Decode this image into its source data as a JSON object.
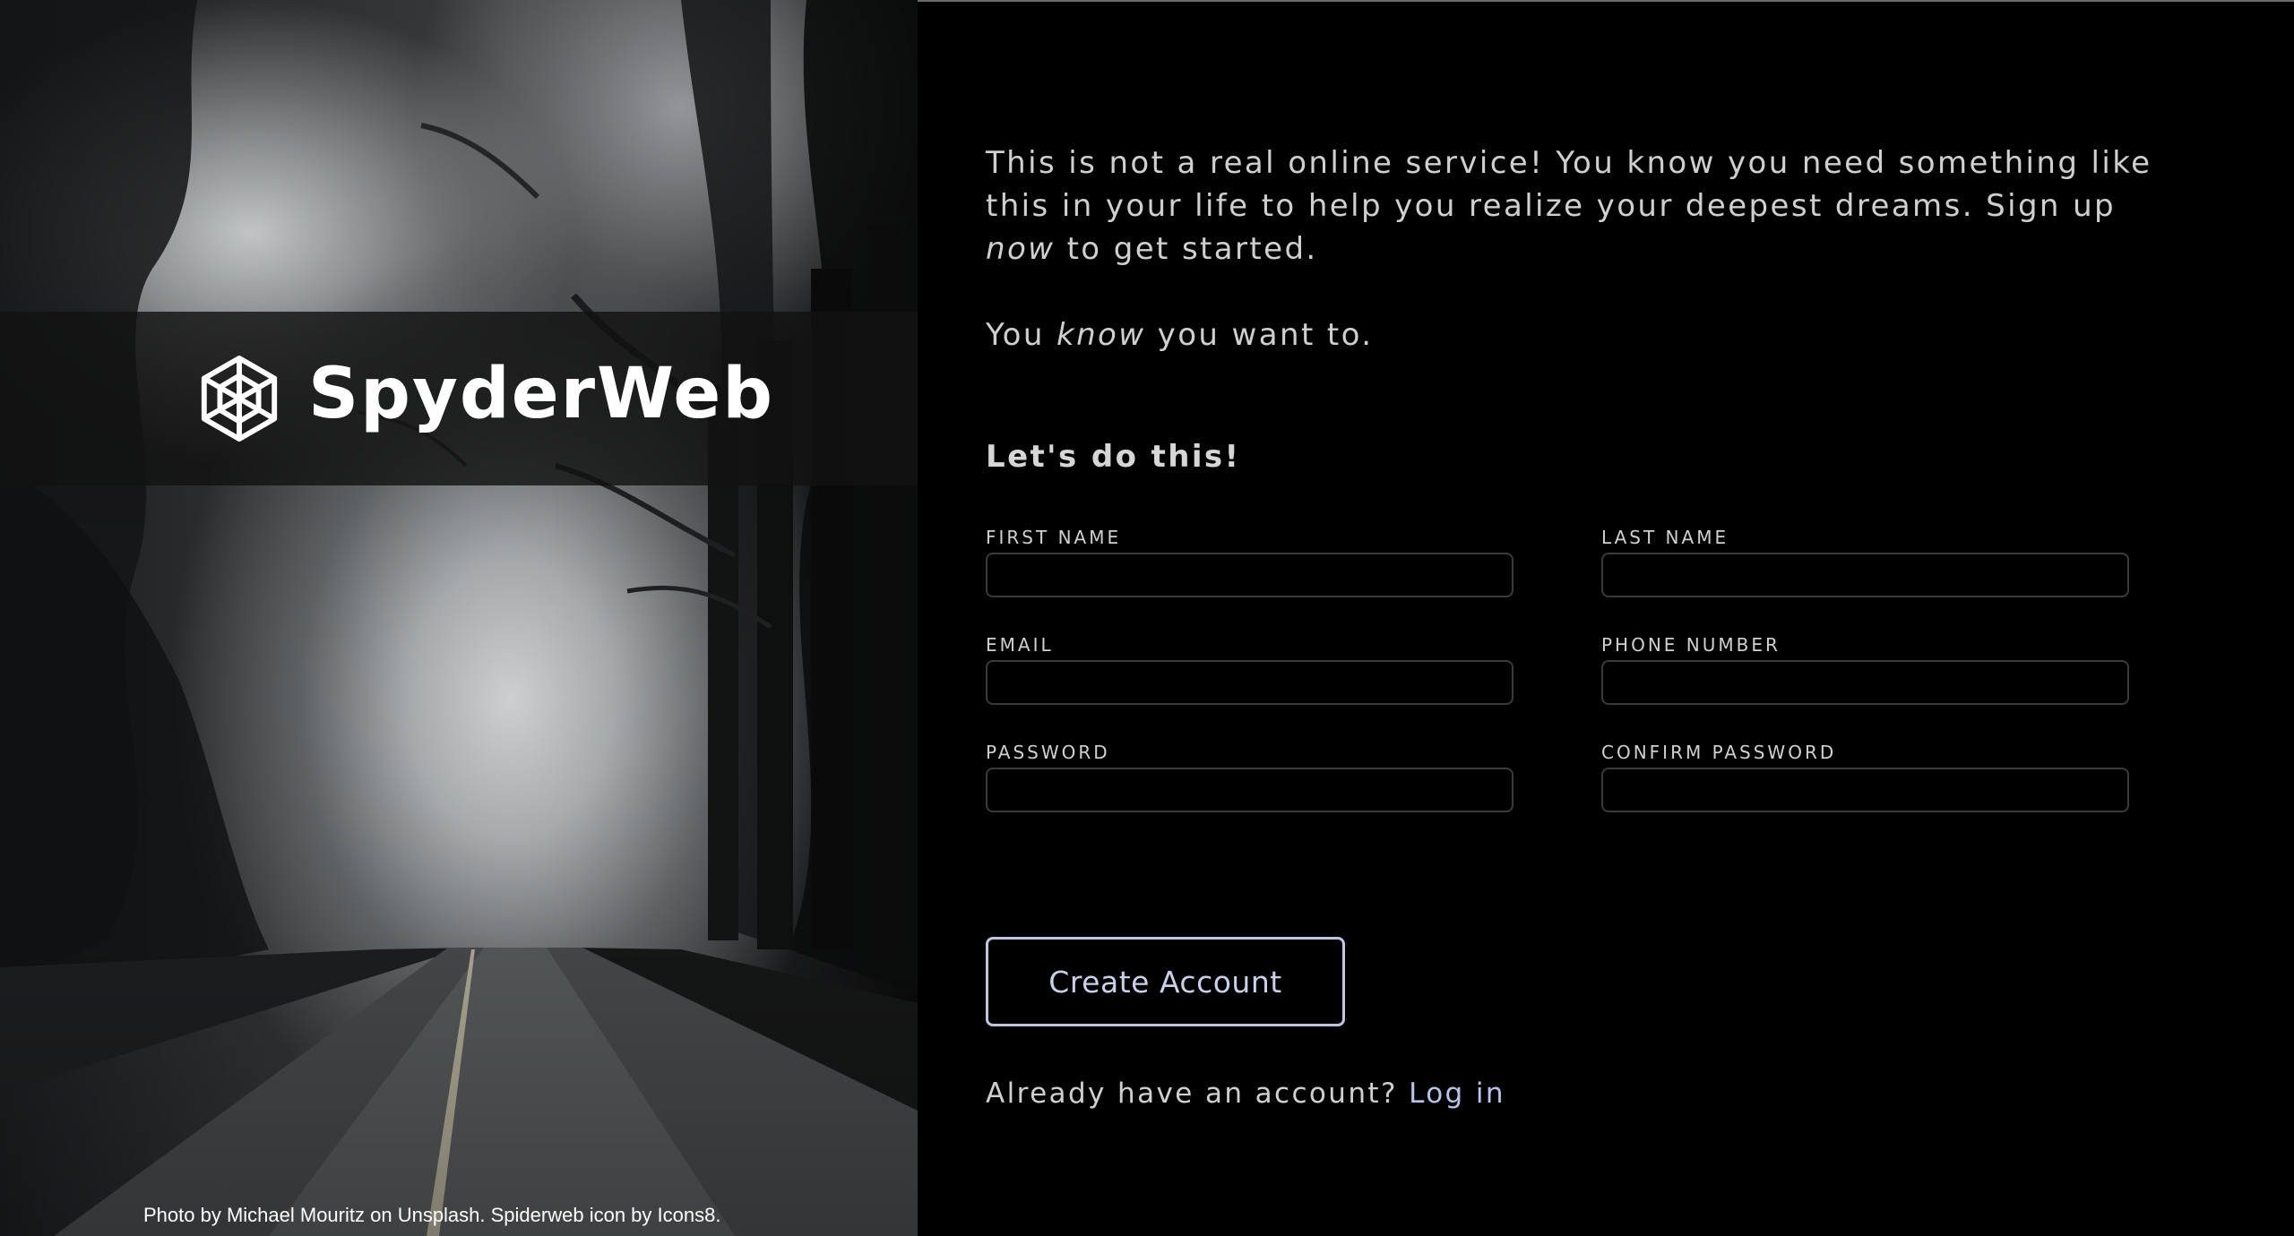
{
  "brand": {
    "name": "SpyderWeb",
    "logo_icon": "spiderweb-icon"
  },
  "credit": "Photo by Michael Mouritz on Unsplash. Spiderweb icon by Icons8.",
  "intro": {
    "part1": "This is not a real online service! You know you need something like this in your life to help you realize your deepest dreams. Sign up ",
    "emphasis": "now",
    "part2": " to get started."
  },
  "tagline": {
    "part1": "You ",
    "emphasis": "know",
    "part2": " you want to."
  },
  "form": {
    "heading": "Let's do this!",
    "fields": {
      "first_name": {
        "label": "FIRST NAME",
        "value": ""
      },
      "last_name": {
        "label": "LAST NAME",
        "value": ""
      },
      "email": {
        "label": "EMAIL",
        "value": ""
      },
      "phone": {
        "label": "PHONE NUMBER",
        "value": ""
      },
      "password": {
        "label": "PASSWORD",
        "value": ""
      },
      "confirm_password": {
        "label": "CONFIRM PASSWORD",
        "value": ""
      }
    },
    "submit_label": "Create Account"
  },
  "login": {
    "prompt": "Already have an account? ",
    "link_label": "Log in"
  },
  "colors": {
    "background": "#000000",
    "text": "#cfcfcf",
    "accent": "#b7c3ea",
    "input_border": "#3a3a3a"
  }
}
